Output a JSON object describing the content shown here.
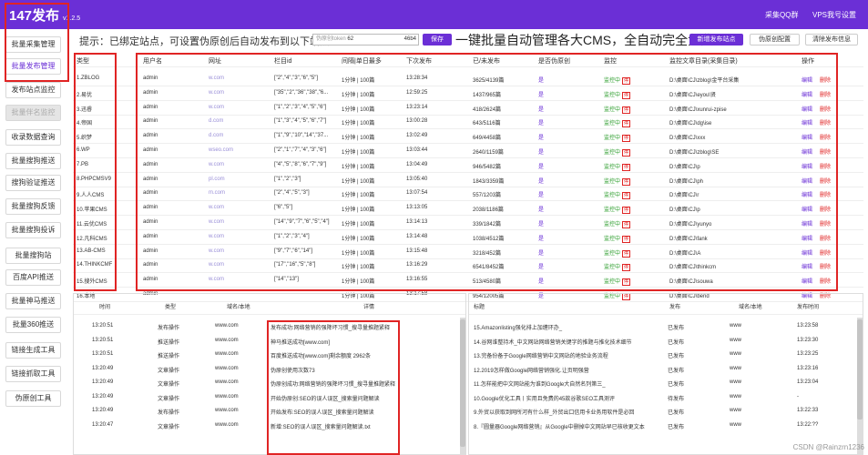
{
  "app": {
    "title": "147发布",
    "version": "v1.2.5"
  },
  "top_links": [
    "采集QQ群",
    "VPS我号设置"
  ],
  "sidebar": [
    {
      "label": "批量采集管理"
    },
    {
      "label": "批量发布管理"
    },
    {
      "label": "发布站点监控"
    },
    {
      "label": "批量伴名监控"
    },
    {
      "label": "收录数据查询"
    },
    {
      "label": "批量搜狗推送"
    },
    {
      "label": "搜狗验证推送"
    },
    {
      "label": "批量搜狗反馈"
    },
    {
      "label": "批量搜狗投诉"
    },
    {
      "label": "批量搜狗站"
    },
    {
      "label": "百度API推送"
    },
    {
      "label": "批量神马推送"
    },
    {
      "label": "批量360推送"
    },
    {
      "label": "链接生成工具"
    },
    {
      "label": "链接抓取工具"
    },
    {
      "label": "伪原创工具"
    }
  ],
  "toolbar": {
    "tip": "提示：已绑定站点，可设置伪原创后自动发布到以下站点",
    "token_placeholder": "伪原创token",
    "token_value_a": "62",
    "token_value_b": "46b4",
    "save": "保存",
    "slogan": "一键批量自动管理各大CMS，全自动完全免费",
    "add_site": "新增发布站点",
    "pseudo_original": "伪原创配置",
    "clear_info": "清除发布信息"
  },
  "table": {
    "headers": [
      "类型",
      "用户名",
      "网址",
      "栏目id",
      "间隔|单日最多",
      "下次发布",
      "已/未发布",
      "是否伪原创",
      "监控",
      "监控文章目录(采集目录)",
      "操作"
    ],
    "rows": [
      {
        "type": "1.ZBLOG",
        "user": "admin",
        "url": "w.com",
        "col": "[\"2\",\"4\",\"3\",\"6\",\"5\"]",
        "interval": "1分钟 | 100篇",
        "next": "13:28:34",
        "count": "3625/4139篇",
        "pseudo": "是",
        "mon": "监控中",
        "dir": "D:\\桌面\\CJ\\zblog\\金平台采集",
        "ops": [
          "编辑",
          "删除"
        ]
      },
      {
        "type": "2.易优",
        "user": "admin",
        "url": "w.com",
        "col": "[\"35\",\"2\",\"36\",\"38\",\"6...",
        "interval": "1分钟 | 100篇",
        "next": "12:59:25",
        "count": "1437/965篇",
        "pseudo": "是",
        "mon": "监控中",
        "dir": "D:\\桌面\\CJ\\eyou\\贤",
        "ops": [
          "编辑",
          "删除"
        ]
      },
      {
        "type": "3.迅睿",
        "user": "admin",
        "url": "w.com",
        "col": "[\"1\",\"2\",\"3\",\"4\",\"5\",\"6\"]",
        "interval": "1分钟 | 100篇",
        "next": "13:23:14",
        "count": "418/2624篇",
        "pseudo": "是",
        "mon": "监控中",
        "dir": "D:\\桌面\\CJ\\xunrui-zpise",
        "ops": [
          "编辑",
          "删除"
        ]
      },
      {
        "type": "4.帝国",
        "user": "admin",
        "url": "d.com",
        "col": "[\"1\",\"3\",\"4\",\"5\",\"6\",\"7\"]",
        "interval": "1分钟 | 100篇",
        "next": "13:00:28",
        "count": "643/5116篇",
        "pseudo": "是",
        "mon": "监控中",
        "dir": "D:\\桌面\\CJ\\dg\\ise",
        "ops": [
          "编辑",
          "删除"
        ]
      },
      {
        "type": "5.织梦",
        "user": "admin",
        "url": "d.com",
        "col": "[\"1\",\"9\",\"10\",\"14\",\"37...",
        "interval": "1分钟 | 100篇",
        "next": "13:02:49",
        "count": "649/4458篇",
        "pseudo": "是",
        "mon": "监控中",
        "dir": "D:\\桌面\\CJ\\xxx",
        "ops": [
          "编辑",
          "删除"
        ]
      },
      {
        "type": "6.WP",
        "user": "admin",
        "url": "wseo.com",
        "col": "[\"2\",\"1\",\"7\",\"4\",\"3\",\"6\"]",
        "interval": "1分钟 | 100篇",
        "next": "13:03:44",
        "count": "2640/1159篇",
        "pseudo": "是",
        "mon": "监控中",
        "dir": "D:\\桌面\\CJ\\zblog\\SE",
        "ops": [
          "编辑",
          "删除"
        ]
      },
      {
        "type": "7.PB",
        "user": "admin",
        "url": "w.com",
        "col": "[\"4\",\"5\",\"8\",\"6\",\"7\",\"9\"]",
        "interval": "1分钟 | 100篇",
        "next": "13:04:49",
        "count": "946/5482篇",
        "pseudo": "是",
        "mon": "监控中",
        "dir": "D:\\桌面\\CJ\\p",
        "ops": [
          "编辑",
          "删除"
        ]
      },
      {
        "type": "8.PHPCMSV9",
        "user": "admin",
        "url": "pl.com",
        "col": "[\"1\",\"2\",\"3\"]",
        "interval": "1分钟 | 100篇",
        "next": "13:05:40",
        "count": "1843/3359篇",
        "pseudo": "是",
        "mon": "监控中",
        "dir": "D:\\桌面\\CJ\\ph",
        "ops": [
          "编辑",
          "删除"
        ]
      },
      {
        "type": "9.人人CMS",
        "user": "admin",
        "url": "m.com",
        "col": "[\"2\",\"4\",\"5\",\"3\"]",
        "interval": "1分钟 | 100篇",
        "next": "13:07:54",
        "count": "557/1203篇",
        "pseudo": "是",
        "mon": "监控中",
        "dir": "D:\\桌面\\CJ\\r",
        "ops": [
          "编辑",
          "删除"
        ]
      },
      {
        "type": "10.苹果CMS",
        "user": "admin",
        "url": "w.com",
        "col": "[\"6\",\"5\"]",
        "interval": "1分钟 | 100篇",
        "next": "13:13:05",
        "count": "2038/1186篇",
        "pseudo": "是",
        "mon": "监控中",
        "dir": "D:\\桌面\\CJ\\p",
        "ops": [
          "编辑",
          "删除"
        ]
      },
      {
        "type": "11.云优CMS",
        "user": "admin",
        "url": "w.com",
        "col": "[\"14\",\"9\",\"7\",\"6\",\"5\",\"4\"]",
        "interval": "1分钟 | 100篇",
        "next": "13:14:13",
        "count": "339/1842篇",
        "pseudo": "是",
        "mon": "监控中",
        "dir": "D:\\桌面\\CJ\\yunyo",
        "ops": [
          "编辑",
          "删除"
        ]
      },
      {
        "type": "12.凡科CMS",
        "user": "admin",
        "url": "w.com",
        "col": "[\"1\",\"2\",\"3\",\"4\"]",
        "interval": "1分钟 | 100篇",
        "next": "13:14:48",
        "count": "1038/4512篇",
        "pseudo": "是",
        "mon": "监控中",
        "dir": "D:\\桌面\\CJ\\fank",
        "ops": [
          "编辑",
          "删除"
        ]
      },
      {
        "type": "13.AB-CMS",
        "user": "admin",
        "url": "w.com",
        "col": "[\"9\",\"7\",\"6\",\"14\"]",
        "interval": "1分钟 | 100篇",
        "next": "13:15:48",
        "count": "3218/452篇",
        "pseudo": "是",
        "mon": "监控中",
        "dir": "D:\\桌面\\CJ\\A",
        "ops": [
          "编辑",
          "删除"
        ]
      },
      {
        "type": "14.THINKCMF",
        "user": "admin",
        "url": "w.com",
        "col": "[\"17\",\"16\",\"5\",\"8\"]",
        "interval": "1分钟 | 100篇",
        "next": "13:16:29",
        "count": "6541/8452篇",
        "pseudo": "是",
        "mon": "监控中",
        "dir": "D:\\桌面\\CJ\\thinkcm",
        "ops": [
          "编辑",
          "删除"
        ]
      },
      {
        "type": "15.搜外CMS",
        "user": "admin",
        "url": "w.com",
        "col": "[\"14\",\"13\"]",
        "interval": "1分钟 | 100篇",
        "next": "13:16:55",
        "count": "513/4580篇",
        "pseudo": "是",
        "mon": "监控中",
        "dir": "D:\\桌面\\CJ\\souwa",
        "ops": [
          "编辑",
          "删除"
        ]
      },
      {
        "type": "16.本地",
        "user": "admin",
        "url": "",
        "col": "",
        "interval": "1分钟 | 100篇",
        "next": "13:17:58",
        "count": "954/12005篇",
        "pseudo": "是",
        "mon": "监控中",
        "dir": "D:\\桌面\\CJ\\bend",
        "ops": [
          "编辑",
          "删除"
        ]
      }
    ]
  },
  "log": {
    "headers": [
      "时间",
      "类型",
      "域名/本地",
      "详情"
    ],
    "rows": [
      {
        "time": "13:20:51",
        "type": "发布操作",
        "domain": "www.com",
        "detail": "发布成功:网络营销的强降坏习惯_搜寻量推题紧释"
      },
      {
        "time": "13:20:51",
        "type": "推送操作",
        "domain": "www.com",
        "detail": "神马推送成功[www.com]"
      },
      {
        "time": "13:20:51",
        "type": "推送操作",
        "domain": "www.com",
        "detail": "百度推送成功[www.com]剩余额度 2962条"
      },
      {
        "time": "13:20:49",
        "type": "文章操作",
        "domain": "www.com",
        "detail": "伪原创使用次数73"
      },
      {
        "time": "13:20:49",
        "type": "文章操作",
        "domain": "www.com",
        "detail": "伪原创成功:网络营销的强降坏习惯_搜寻量推题紧释"
      },
      {
        "time": "13:20:49",
        "type": "文章操作",
        "domain": "www.com",
        "detail": "开始伪原创:SEO的误人误区_搜索量问题解读"
      },
      {
        "time": "13:20:49",
        "type": "发布操作",
        "domain": "www.com",
        "detail": "开始发布:SEO的误人误区_搜索量问题解读"
      },
      {
        "time": "13:20:47",
        "type": "文章操作",
        "domain": "www.com",
        "detail": "新增:SEO的误人误区_搜索量问题解读.txt"
      }
    ]
  },
  "titles": {
    "headers": [
      "标题",
      "发布",
      "域名/本地",
      "发布时间"
    ],
    "rows": [
      {
        "title": "15.Amazonlisting强化排上加缠环办_",
        "status": "已发布",
        "domain": "www",
        "time": "13:23:58"
      },
      {
        "title": "14.谷网谁整持术_中文网站网络营销关键字的推题与推化技术细节",
        "status": "已发布",
        "domain": "www",
        "time": "13:23:30"
      },
      {
        "title": "13.完备份备于Google网络营销中文网站的地验业务流程",
        "status": "已发布",
        "domain": "www",
        "time": "13:23:25"
      },
      {
        "title": "12.2019怎样做Google网络营销强化.让页明强营",
        "status": "已发布",
        "domain": "www",
        "time": "13:23:16"
      },
      {
        "title": "11.怎样能把中文网站能为谁到Google大自然名列第三_",
        "status": "已发布",
        "domain": "www",
        "time": "13:23:04"
      },
      {
        "title": "10.Google优化工具丨实用且免费的45款谷歌SEO工具测评",
        "status": "待发布",
        "domain": "www",
        "time": "-"
      },
      {
        "title": "9.外贸以获取到网所河有什么样_外贸出口信用卡业务用软件是必回",
        "status": "已发布",
        "domain": "www",
        "time": "13:22:33"
      },
      {
        "title": "8.『圆量器Google网络营销』从Google中删掉中文网站早已核收更文本",
        "status": "已发布",
        "domain": "www",
        "time": "13:22:??"
      }
    ]
  },
  "watermark": "CSDN @Rainzrn1236",
  "colors": {
    "brand": "#6b2fd6",
    "annotation": "#e02424"
  }
}
